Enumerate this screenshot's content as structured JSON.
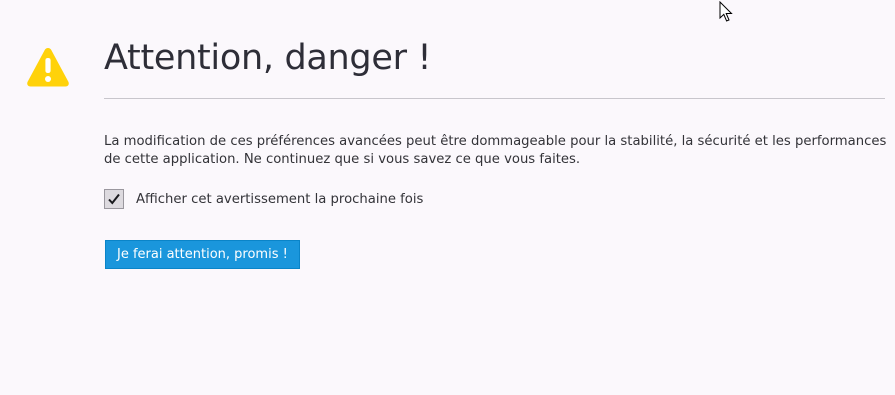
{
  "header": {
    "title": "Attention, danger !",
    "icon": "warning-icon"
  },
  "message": {
    "text": "La modification de ces préférences avancées peut être dommageable pour la stabilité, la sécurité et les performances de cette application. Ne continuez que si vous savez ce que vous faites."
  },
  "checkbox": {
    "label": "Afficher cet avertissement la prochaine fois",
    "checked": true
  },
  "actions": {
    "accept_label": "Je ferai attention, promis !"
  },
  "colors": {
    "warning": "#ffd20a",
    "button": "#1a96dc",
    "background": "#fbf8fc"
  }
}
